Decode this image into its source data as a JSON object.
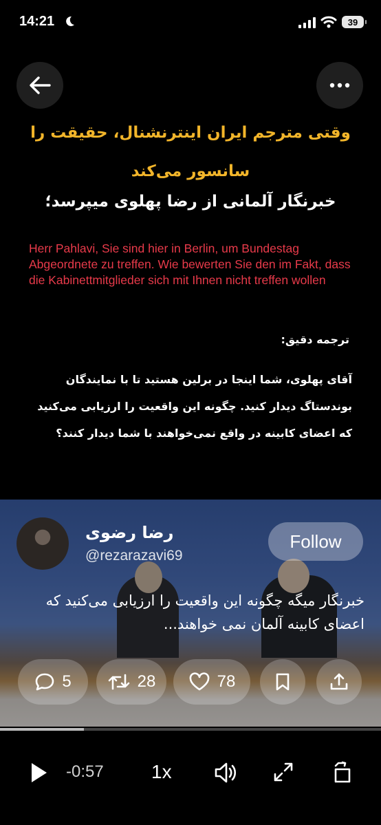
{
  "status_bar": {
    "time": "14:21",
    "battery": "39"
  },
  "headline": "وقتی مترجم ایران اینترنشنال، حقیقت را سانسور می‌کند",
  "question_title": "خبرنگار آلمانی از رضا پهلوی میپرسد؛",
  "german_quote": "Herr Pahlavi, Sie sind hier in Berlin, um Bundestag Abgeordnete zu treffen. Wie bewerten Sie den im Fakt, dass die Kabinettmitglieder sich mit Ihnen nicht treffen wollen",
  "translation_label": "ترجمه دقیق:",
  "translation_body": "آقای پهلوی، شما اینجا در برلین هستید تا با نمایندگان بوندستاگ دیدار کنید. چگونه این واقعیت را ارزیابی می‌کنید که اعضای کابینه در واقع نمی‌خواهند با شما دیدار کنند؟",
  "post": {
    "author_name": "رضا رضوی",
    "author_handle": "@rezarazavi69",
    "follow_label": "Follow",
    "text": "خبرنگار میگه چگونه این واقعیت را ارزیابی می‌کنید که اعضای کابینه آلمان نمی خواهند...",
    "counts": {
      "replies": "5",
      "reposts": "28",
      "likes": "78"
    }
  },
  "player": {
    "time_remaining": "-0:57",
    "speed": "1x",
    "progress": 0.22
  }
}
